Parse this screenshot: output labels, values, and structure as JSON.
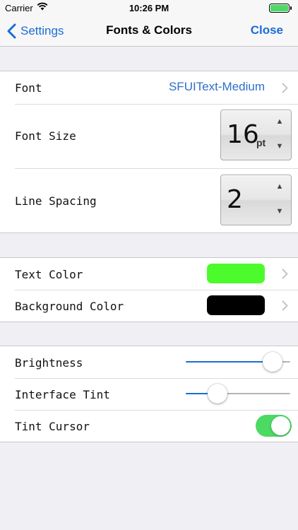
{
  "status_bar": {
    "carrier": "Carrier",
    "time": "10:26 PM"
  },
  "nav": {
    "back_label": "Settings",
    "title": "Fonts & Colors",
    "close_label": "Close"
  },
  "font_group": {
    "font_label": "Font",
    "font_value": "SFUIText-Medium",
    "font_size_label": "Font Size",
    "font_size_value": "16",
    "font_size_unit": "pt",
    "line_spacing_label": "Line Spacing",
    "line_spacing_value": "2"
  },
  "color_group": {
    "text_color_label": "Text Color",
    "text_color": "#4cfb2c",
    "background_color_label": "Background Color",
    "background_color": "#000000"
  },
  "display_group": {
    "brightness_label": "Brightness",
    "brightness_level": 0.91,
    "interface_tint_label": "Interface Tint",
    "interface_tint_level": 0.26,
    "tint_cursor_label": "Tint Cursor",
    "tint_cursor_on": true
  },
  "colors": {
    "accent": "#1a6dd6",
    "toggle_on": "#4cd964"
  },
  "icons": [
    "wifi-icon",
    "battery-icon",
    "back-chevron-icon",
    "chevron-right-icon",
    "stepper-up-icon",
    "stepper-down-icon"
  ]
}
